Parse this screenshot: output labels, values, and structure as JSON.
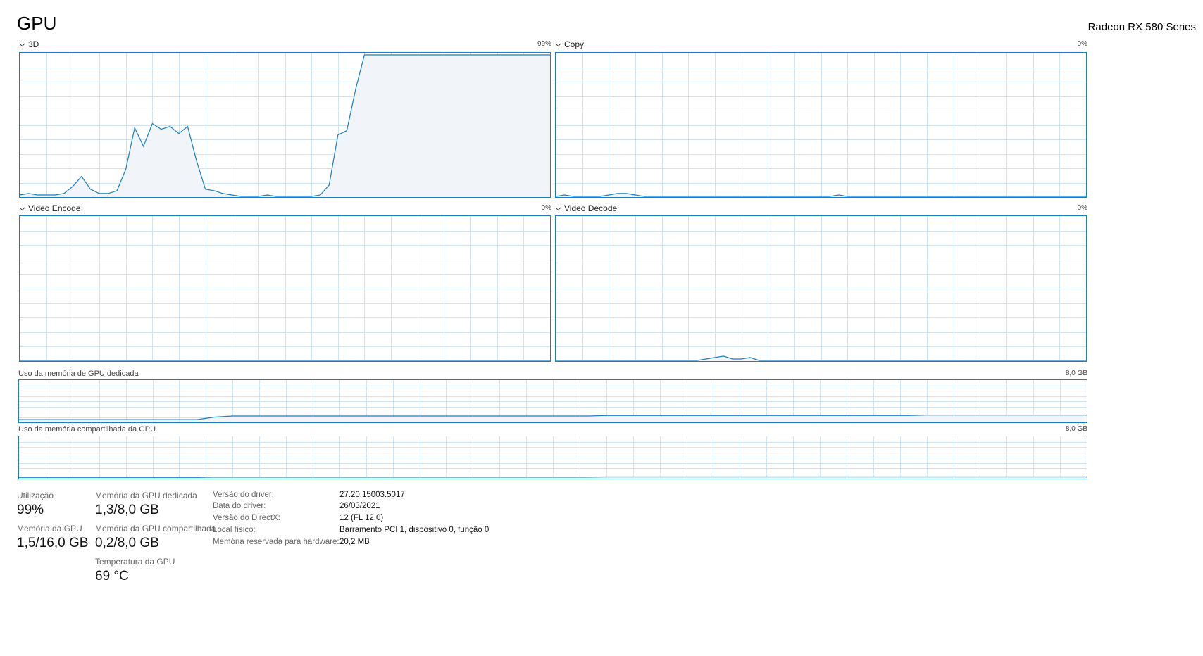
{
  "header": {
    "title": "GPU",
    "device_name": "Radeon RX 580 Series"
  },
  "colors": {
    "border": "#1a7fc1",
    "line": "#1a7fc1",
    "fill": "#f1f5f9",
    "grid": "#cfe4f2"
  },
  "engines": [
    {
      "label": "3D",
      "max_text": "99%"
    },
    {
      "label": "Copy",
      "max_text": "0%"
    },
    {
      "label": "Video Encode",
      "max_text": "0%"
    },
    {
      "label": "Video Decode",
      "max_text": "0%"
    }
  ],
  "memory_graphs": [
    {
      "label": "Uso da memória de GPU dedicada",
      "max_text": "8,0 GB"
    },
    {
      "label": "Uso da memória compartilhada da GPU",
      "max_text": "8,0 GB"
    }
  ],
  "chart_data": [
    {
      "type": "area",
      "name": "3D",
      "ylim": [
        0,
        100
      ],
      "values": [
        1,
        2,
        1,
        1,
        1,
        2,
        7,
        14,
        5,
        2,
        2,
        4,
        19,
        48,
        35,
        51,
        47,
        49,
        44,
        49,
        25,
        5,
        4,
        2,
        1,
        0,
        0,
        0,
        1,
        0,
        0,
        0,
        0,
        0,
        1,
        8,
        43,
        46,
        75,
        99,
        99,
        99,
        99,
        99,
        99,
        99,
        99,
        99,
        99,
        99,
        99,
        99,
        99,
        99,
        99,
        99,
        99,
        99,
        99,
        99,
        99
      ]
    },
    {
      "type": "area",
      "name": "Copy",
      "ylim": [
        0,
        100
      ],
      "values": [
        0,
        1,
        0,
        0,
        0,
        0,
        1,
        2,
        2,
        1,
        0,
        0,
        0,
        0,
        0,
        0,
        0,
        0,
        0,
        0,
        0,
        0,
        0,
        0,
        0,
        0,
        0,
        0,
        0,
        0,
        0,
        0,
        1,
        0,
        0,
        0,
        0,
        0,
        0,
        0,
        0,
        0,
        0,
        0,
        0,
        0,
        0,
        0,
        0,
        0,
        0,
        0,
        0,
        0,
        0,
        0,
        0,
        0,
        0,
        0,
        0
      ]
    },
    {
      "type": "area",
      "name": "Video Encode",
      "ylim": [
        0,
        100
      ],
      "values": [
        0,
        0,
        0,
        0,
        0,
        0,
        0,
        0,
        0,
        0,
        0,
        0,
        0,
        0,
        0,
        0,
        0,
        0,
        0,
        0,
        0,
        0,
        0,
        0,
        0,
        0,
        0,
        0,
        0,
        0,
        0,
        0,
        0,
        0,
        0,
        0,
        0,
        0,
        0,
        0,
        0,
        0,
        0,
        0,
        0,
        0,
        0,
        0,
        0,
        0,
        0,
        0,
        0,
        0,
        0,
        0,
        0,
        0,
        0,
        0,
        0
      ]
    },
    {
      "type": "area",
      "name": "Video Decode",
      "ylim": [
        0,
        100
      ],
      "values": [
        0,
        0,
        0,
        0,
        0,
        0,
        0,
        0,
        0,
        0,
        0,
        0,
        0,
        0,
        0,
        0,
        0,
        1,
        2,
        3,
        1,
        1,
        2,
        0,
        0,
        0,
        0,
        0,
        0,
        0,
        0,
        0,
        0,
        0,
        0,
        0,
        0,
        0,
        0,
        0,
        0,
        0,
        0,
        0,
        0,
        0,
        0,
        0,
        0,
        0,
        0,
        0,
        0,
        0,
        0,
        0,
        0,
        0,
        0,
        0,
        0
      ]
    },
    {
      "type": "area",
      "name": "Uso da memória de GPU dedicada",
      "ylim": [
        0,
        8
      ],
      "values": [
        0.4,
        0.4,
        0.4,
        0.4,
        0.4,
        0.4,
        0.4,
        0.4,
        0.4,
        0.4,
        0.4,
        0.9,
        1.1,
        1.1,
        1.1,
        1.1,
        1.1,
        1.1,
        1.1,
        1.1,
        1.1,
        1.1,
        1.1,
        1.1,
        1.1,
        1.1,
        1.1,
        1.1,
        1.1,
        1.1,
        1.1,
        1.1,
        1.1,
        1.2,
        1.2,
        1.2,
        1.2,
        1.2,
        1.2,
        1.2,
        1.2,
        1.2,
        1.2,
        1.2,
        1.2,
        1.2,
        1.2,
        1.2,
        1.2,
        1.2,
        1.2,
        1.3,
        1.3,
        1.3,
        1.3,
        1.3,
        1.3,
        1.3,
        1.3,
        1.3,
        1.3
      ]
    },
    {
      "type": "area",
      "name": "Uso da memória compartilhada da GPU",
      "ylim": [
        0,
        8
      ],
      "values": [
        0.1,
        0.1,
        0.1,
        0.1,
        0.1,
        0.1,
        0.1,
        0.1,
        0.1,
        0.1,
        0.1,
        0.15,
        0.15,
        0.15,
        0.15,
        0.15,
        0.15,
        0.15,
        0.15,
        0.15,
        0.15,
        0.15,
        0.15,
        0.15,
        0.15,
        0.15,
        0.15,
        0.15,
        0.15,
        0.15,
        0.15,
        0.15,
        0.15,
        0.2,
        0.2,
        0.2,
        0.2,
        0.2,
        0.2,
        0.2,
        0.2,
        0.2,
        0.2,
        0.2,
        0.2,
        0.2,
        0.2,
        0.2,
        0.2,
        0.2,
        0.2,
        0.2,
        0.2,
        0.2,
        0.2,
        0.2,
        0.2,
        0.2,
        0.2,
        0.2,
        0.2
      ]
    }
  ],
  "stats": {
    "utilization": {
      "label": "Utilização",
      "value": "99%"
    },
    "gpu_memory": {
      "label": "Memória da GPU",
      "value": "1,5/16,0 GB"
    },
    "dedicated": {
      "label": "Memória da GPU dedicada",
      "value": "1,3/8,0 GB"
    },
    "shared": {
      "label": "Memória da GPU compartilhada",
      "value": "0,2/8,0 GB"
    },
    "temperature": {
      "label": "Temperatura da GPU",
      "value": "69 °C"
    }
  },
  "info": [
    {
      "label": "Versão do driver:",
      "value": "27.20.15003.5017"
    },
    {
      "label": "Data do driver:",
      "value": "26/03/2021"
    },
    {
      "label": "Versão do DirectX:",
      "value": "12 (FL 12.0)"
    },
    {
      "label": "Local físico:",
      "value": "Barramento PCI 1, dispositivo 0, função 0"
    },
    {
      "label": "Memória reservada para hardware:",
      "value": "20,2 MB"
    }
  ]
}
